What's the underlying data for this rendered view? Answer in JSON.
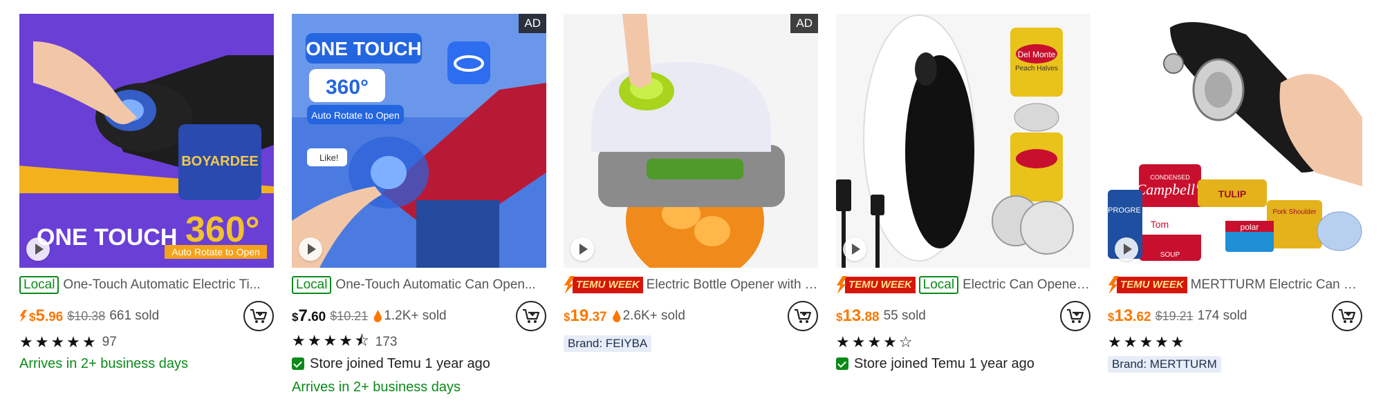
{
  "colors": {
    "accent_orange": "#fb7701",
    "local_green": "#0a8a18",
    "temu_red": "#d6160c"
  },
  "products": [
    {
      "ad": "",
      "tags": [
        "Local"
      ],
      "title": "One-Touch Automatic Electric Ti...",
      "price": {
        "currency": "$",
        "whole": "5",
        "cents": ".96",
        "lightning": true
      },
      "original_price": "$10.38",
      "sold": "661 sold",
      "rating": {
        "stars": "★★★★★",
        "count": "97",
        "value": 4.9
      },
      "arrival": "Arrives in 2+ business days",
      "image_text": [
        "ONE TOUCH",
        "360°",
        "Auto Rotate to Open",
        "BOYARDEE"
      ]
    },
    {
      "ad": "AD",
      "tags": [
        "Local"
      ],
      "title": "One-Touch Automatic Can Open...",
      "price": {
        "currency": "$",
        "whole": "7",
        "cents": ".60"
      },
      "original_price": "$10.21",
      "sold": "1.2K+ sold",
      "rating": {
        "stars": "★★★★⯪",
        "count": "173",
        "value": 4.5
      },
      "store": "Store joined Temu 1 year ago",
      "arrival": "Arrives in 2+ business days",
      "image_text": [
        "ONE TOUCH",
        "360°",
        "Auto Rotate to Open",
        "Like!"
      ]
    },
    {
      "ad": "AD",
      "tags": [
        "TEMU WEEK"
      ],
      "title": "Electric Bottle Opener with T...",
      "price": {
        "currency": "$",
        "whole": "19",
        "cents": ".37"
      },
      "sold": "2.6K+ sold",
      "brand": "Brand: FEIYBA"
    },
    {
      "ad": "",
      "tags": [
        "TEMU WEEK",
        "Local"
      ],
      "title": "Electric Can Opener ...",
      "price": {
        "currency": "$",
        "whole": "13",
        "cents": ".88"
      },
      "sold": "55 sold",
      "rating": {
        "stars": "★★★★☆",
        "value": 4.1
      },
      "store": "Store joined Temu 1 year ago",
      "image_text": [
        "Del Monte",
        "Peach Halves"
      ]
    },
    {
      "ad": "",
      "tags": [
        "TEMU WEEK"
      ],
      "title": "MERTTURM Electric Can Op...",
      "price": {
        "currency": "$",
        "whole": "13",
        "cents": ".62"
      },
      "original_price": "$19.21",
      "sold": "174 sold",
      "rating": {
        "stars": "★★★★★",
        "value": 5.0
      },
      "brand": "Brand: MERTTURM",
      "image_text": [
        "Campbell's",
        "TULIP",
        "Pork Shoulder",
        "polar",
        "PROGRE",
        "Tom",
        "SOUP",
        "CONDENSED"
      ]
    }
  ]
}
